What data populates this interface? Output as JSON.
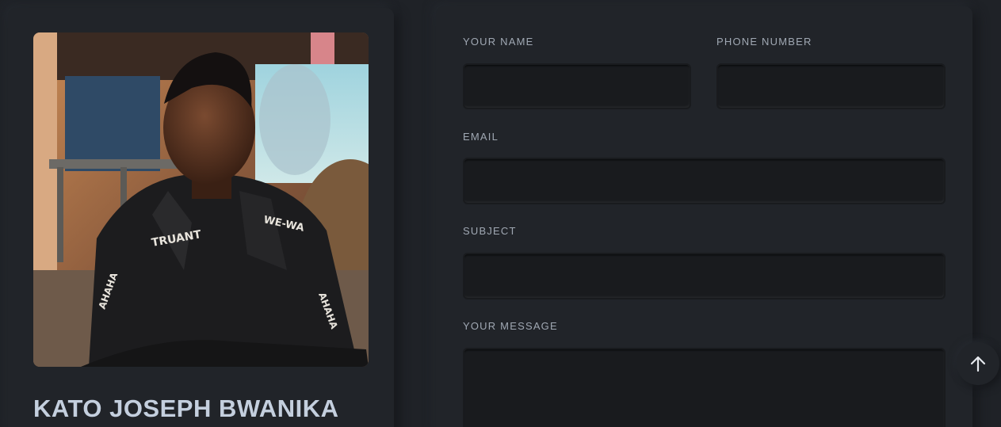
{
  "profile": {
    "name": "KATO JOSEPH BWANIKA",
    "photo_alt": "Portrait photo"
  },
  "contact_form": {
    "name_label": "YOUR NAME",
    "name_value": "",
    "phone_label": "PHONE NUMBER",
    "phone_value": "",
    "email_label": "EMAIL",
    "email_value": "",
    "subject_label": "SUBJECT",
    "subject_value": "",
    "message_label": "YOUR MESSAGE",
    "message_value": ""
  },
  "scroll_top": {
    "icon": "arrow-up-icon"
  },
  "colors": {
    "background": "#1f2227",
    "card": "#212429",
    "input": "#191b1e",
    "heading": "#c4cfde",
    "label": "#a0a8b3"
  }
}
